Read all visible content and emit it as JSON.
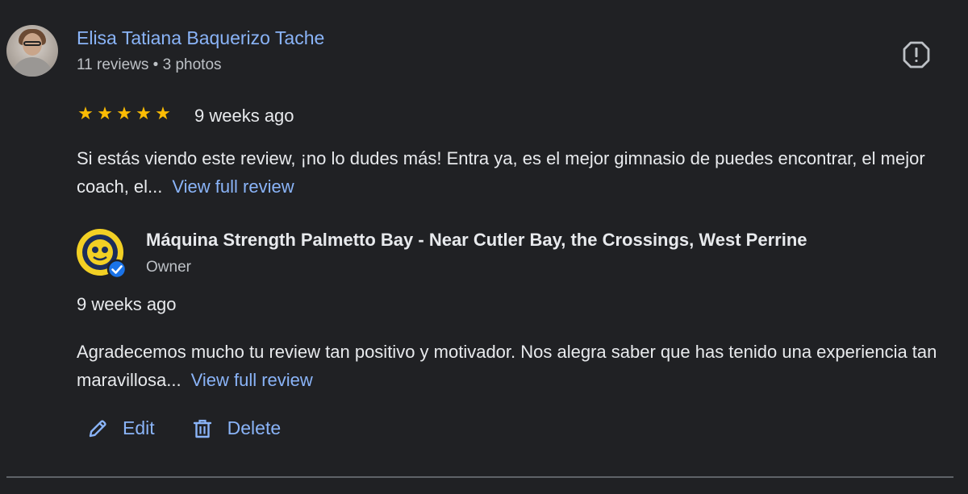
{
  "review": {
    "reviewer_name": "Elisa Tatiana Baquerizo Tache",
    "reviewer_meta": "11 reviews • 3 photos",
    "rating": 5,
    "star_glyph": "★",
    "date": "9 weeks ago",
    "text": "Si estás viendo este review, ¡no lo dudes más! Entra ya, es el mejor gimnasio de puedes encontrar, el mejor coach, el...",
    "view_full_label": "View full review",
    "report_icon": "report-flag-icon"
  },
  "owner_reply": {
    "name": "Máquina Strength Palmetto Bay - Near Cutler Bay, the Crossings, West Perrine",
    "role": "Owner",
    "date": "9 weeks ago",
    "text": "Agradecemos mucho tu review tan positivo y motivador. Nos alegra saber que has tenido una experiencia tan maravillosa...",
    "view_full_label": "View full review",
    "verified_icon": "verified-check-icon"
  },
  "actions": {
    "edit_label": "Edit",
    "delete_label": "Delete"
  },
  "colors": {
    "background": "#202124",
    "link": "#8ab4f8",
    "star": "#fbbc04",
    "text": "#e8eaed",
    "secondary_text": "#bdc1c6"
  }
}
